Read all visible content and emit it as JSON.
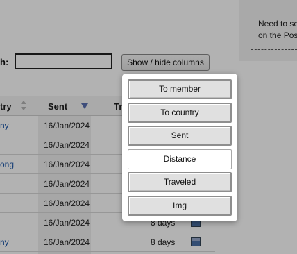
{
  "side_note": {
    "line1": "Need to se",
    "line2": "on the Pos"
  },
  "search": {
    "label": "h:",
    "value": "",
    "placeholder": ""
  },
  "show_hide_button": {
    "label": "Show / hide columns"
  },
  "table": {
    "headers": {
      "country": "try",
      "sent": "Sent",
      "traveled": "Tr"
    },
    "rows": [
      {
        "country": "ny",
        "sent": "16/Jan/2024",
        "days": "",
        "img": false
      },
      {
        "country": "",
        "sent": "16/Jan/2024",
        "days": "",
        "img": false
      },
      {
        "country": "ong",
        "sent": "16/Jan/2024",
        "days": "",
        "img": false
      },
      {
        "country": "",
        "sent": "16/Jan/2024",
        "days": "",
        "img": false
      },
      {
        "country": "",
        "sent": "16/Jan/2024",
        "days": "",
        "img": false
      },
      {
        "country": "",
        "sent": "16/Jan/2024",
        "days": "8 days",
        "img": true
      },
      {
        "country": "ny",
        "sent": "16/Jan/2024",
        "days": "8 days",
        "img": true
      }
    ]
  },
  "column_menu": {
    "items": [
      {
        "label": "To member",
        "state": "on"
      },
      {
        "label": "To country",
        "state": "on"
      },
      {
        "label": "Sent",
        "state": "on"
      },
      {
        "label": "Distance",
        "state": "off"
      },
      {
        "label": "Traveled",
        "state": "on"
      },
      {
        "label": "Img",
        "state": "on"
      }
    ]
  },
  "colors": {
    "overlay": "#000000",
    "link": "#1a55a8",
    "sort_active": "#5a6fb0",
    "sort_inactive": "#b5b5b5"
  }
}
